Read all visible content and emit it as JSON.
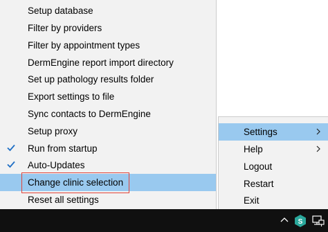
{
  "submenu": {
    "items": [
      {
        "label": "Setup database",
        "checked": false
      },
      {
        "label": "Filter by providers",
        "checked": false
      },
      {
        "label": "Filter by appointment types",
        "checked": false
      },
      {
        "label": "DermEngine report import directory",
        "checked": false
      },
      {
        "label": "Set up pathology results folder",
        "checked": false
      },
      {
        "label": "Export settings to file",
        "checked": false
      },
      {
        "label": "Sync contacts to DermEngine",
        "checked": false
      },
      {
        "label": "Setup proxy",
        "checked": false
      },
      {
        "label": "Run from startup",
        "checked": true
      },
      {
        "label": "Auto-Updates",
        "checked": true
      },
      {
        "label": "Change clinic selection",
        "checked": false,
        "highlighted": true
      },
      {
        "label": "Reset all settings",
        "checked": false
      }
    ]
  },
  "mainmenu": {
    "items": [
      {
        "label": "Settings",
        "has_submenu": true,
        "highlighted": true
      },
      {
        "label": "Help",
        "has_submenu": true
      },
      {
        "label": "Logout",
        "has_submenu": false
      },
      {
        "label": "Restart",
        "has_submenu": false
      },
      {
        "label": "Exit",
        "has_submenu": false
      }
    ]
  },
  "taskbar": {
    "tray_icons": [
      "chevron-up-icon",
      "dermengine-tray-icon",
      "network-icon"
    ]
  },
  "colors": {
    "menu_bg": "#f2f2f2",
    "highlight": "#99c9ef",
    "selection_border": "#e0443a",
    "check": "#1f6fc5",
    "taskbar": "#101010",
    "app_icon": "#2aa79b"
  }
}
